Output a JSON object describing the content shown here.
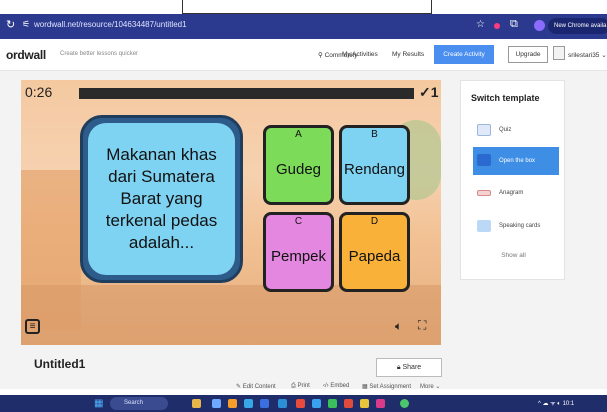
{
  "browser": {
    "url": "wordwall.net/resource/104634487/untitled1",
    "new_chrome_label": "New Chrome availa"
  },
  "header": {
    "logo": "ordwall",
    "tagline": "Create better lessons quicker",
    "community": "Community",
    "my_activities": "My Activities",
    "my_results": "My Results",
    "create_activity": "Create Activity",
    "upgrade": "Upgrade",
    "username": "srilestari35"
  },
  "game": {
    "timer": "0:26",
    "score": "✓1",
    "question": "Makanan khas dari Sumatera Barat yang terkenal pedas adalah...",
    "answers": [
      {
        "letter": "A",
        "label": "Gudeg",
        "color": "#7ddb5a"
      },
      {
        "letter": "B",
        "label": "Rendang",
        "color": "#7fd3f2"
      },
      {
        "letter": "C",
        "label": "Pempek",
        "color": "#e487e0"
      },
      {
        "letter": "D",
        "label": "Papeda",
        "color": "#f9b13a"
      }
    ]
  },
  "switch_template": {
    "title": "Switch template",
    "items": [
      {
        "label": "Quiz",
        "selected": false,
        "icon": "quiz-icon"
      },
      {
        "label": "Open the box",
        "selected": true,
        "icon": "open-box-icon"
      },
      {
        "label": "Anagram",
        "selected": false,
        "icon": "anagram-icon"
      },
      {
        "label": "Speaking cards",
        "selected": false,
        "icon": "speaking-cards-icon"
      }
    ],
    "show_all": "Show all"
  },
  "page": {
    "title": "Untitled1",
    "share": "Share",
    "actions": {
      "edit": "Edit Content",
      "print": "Print",
      "embed": "Embed",
      "assignment": "Set Assignment",
      "more": "More"
    }
  },
  "taskbar": {
    "search": "Search",
    "time": "10:1"
  }
}
